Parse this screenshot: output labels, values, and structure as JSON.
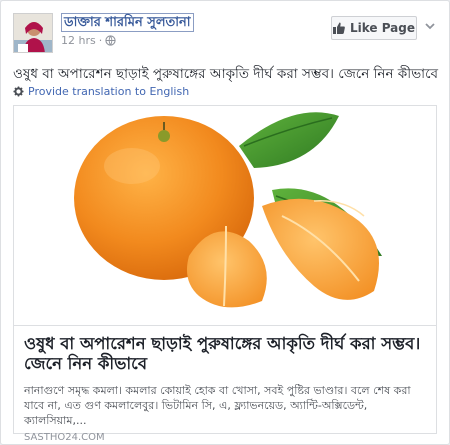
{
  "post": {
    "author": "ডাক্তার শারমিন সুলতানা",
    "time": "12 hrs",
    "time_separator": "·",
    "like_button_label": "Like Page",
    "text": "ওষুধ বা অপারেশন ছাড়াই পুরুষাঙ্গের আকৃতি দীর্ঘ করা সম্ভব। জেনে নিন কীভাবে",
    "translate_label": "Provide translation to English"
  },
  "link_preview": {
    "title": "ওষুধ বা অপারেশন ছাড়াই পুরুষাঙ্গের আকৃতি দীর্ঘ করা সম্ভব। জেনে নিন কীভাবে",
    "description": "নানাগুণে সমৃদ্ধ কমলা। কমলার কোয়াই হোক বা খোসা, সবই পুষ্টির ভাণ্ডার। বলে শেষ করা যাবে না, এত গুণ কমলালেবুর। ভিটামিন সি, এ, ফ্ল্যাভনয়েড, অ্যান্টি-অক্সিডেন্ট, ক্যালসিয়াম,...",
    "domain": "SASTHO24.COM"
  },
  "icons": {
    "globe": "globe-icon",
    "like": "thumbs-up-icon",
    "options": "chevron-down-icon",
    "settings": "gear-icon"
  },
  "colors": {
    "link_blue": "#365899",
    "accent_blue": "#4267b2",
    "muted": "#90949c",
    "orange": "#f28a1e",
    "leaf": "#3d8f2a"
  }
}
